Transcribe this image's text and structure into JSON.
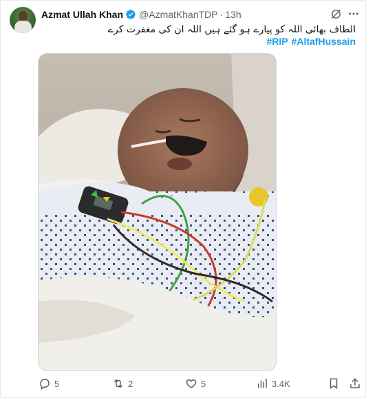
{
  "tweet": {
    "display_name": "Azmat Ullah Khan",
    "handle": "@AzmatKhanTDP",
    "separator": "·",
    "time": "13h",
    "text": "الطاف بھائی اللہ کو پیارے ہو گئے ہیں اللہ ان کی مغفرت کرے",
    "hashtags": [
      "#RIP",
      "#AltafHussain"
    ]
  },
  "actions": {
    "replies": "5",
    "reposts": "2",
    "likes": "5",
    "views": "3.4K"
  },
  "icons": {
    "verified": "verified-badge-icon",
    "grok": "grok-icon",
    "more": "more-icon",
    "reply": "reply-icon",
    "repost": "repost-icon",
    "like": "like-icon",
    "views": "views-icon",
    "bookmark": "bookmark-icon",
    "share": "share-icon"
  },
  "colors": {
    "link": "#1d9bf0",
    "verified": "#1d9bf0",
    "muted": "#536471",
    "text": "#0f1419"
  }
}
